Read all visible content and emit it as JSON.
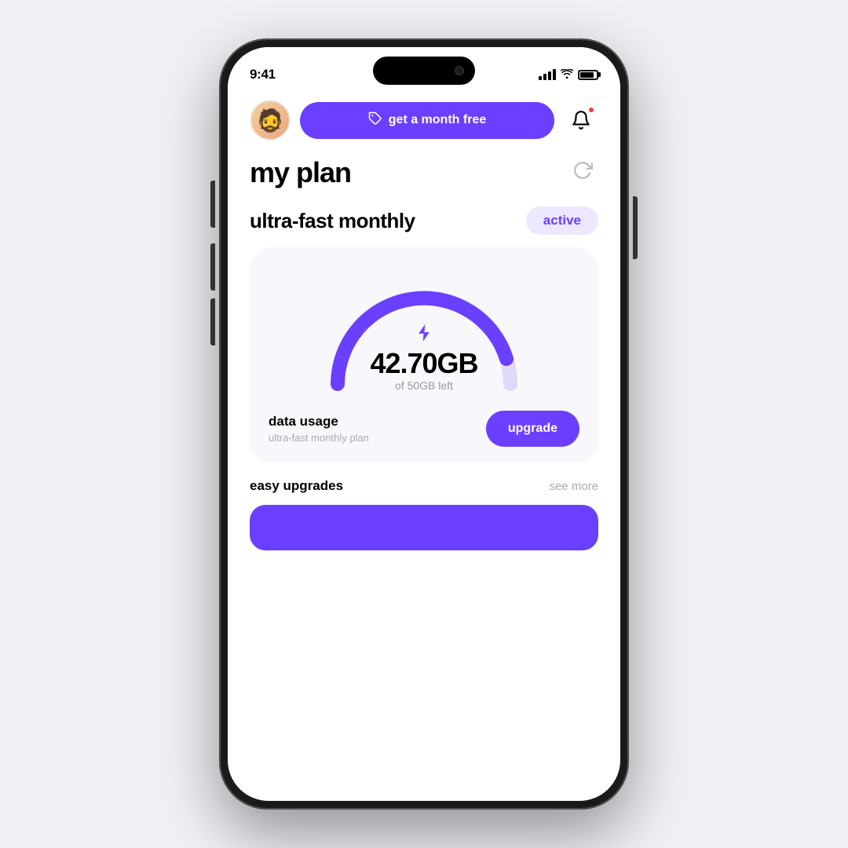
{
  "status_bar": {
    "time": "9:41",
    "battery_label": "battery"
  },
  "header": {
    "promo_button_label": "get a month free",
    "promo_tag_icon": "🏷",
    "notification_badge": "1"
  },
  "page": {
    "title": "my plan",
    "plan_name": "ultra-fast monthly",
    "active_label": "active"
  },
  "data_gauge": {
    "value": "42.70GB",
    "sub_label": "of 50GB left",
    "lightning_icon": "⚡",
    "used_percent": 85.4,
    "track_color": "#e0d8f8",
    "fill_color": "#6b3fff"
  },
  "card": {
    "data_usage_label": "data usage",
    "data_usage_sub": "ultra-fast monthly plan",
    "upgrade_label": "upgrade"
  },
  "bottom": {
    "easy_upgrades_label": "easy upgrades",
    "see_more_label": "see more"
  },
  "avatar_emoji": "🧔",
  "refresh_icon": "↻"
}
